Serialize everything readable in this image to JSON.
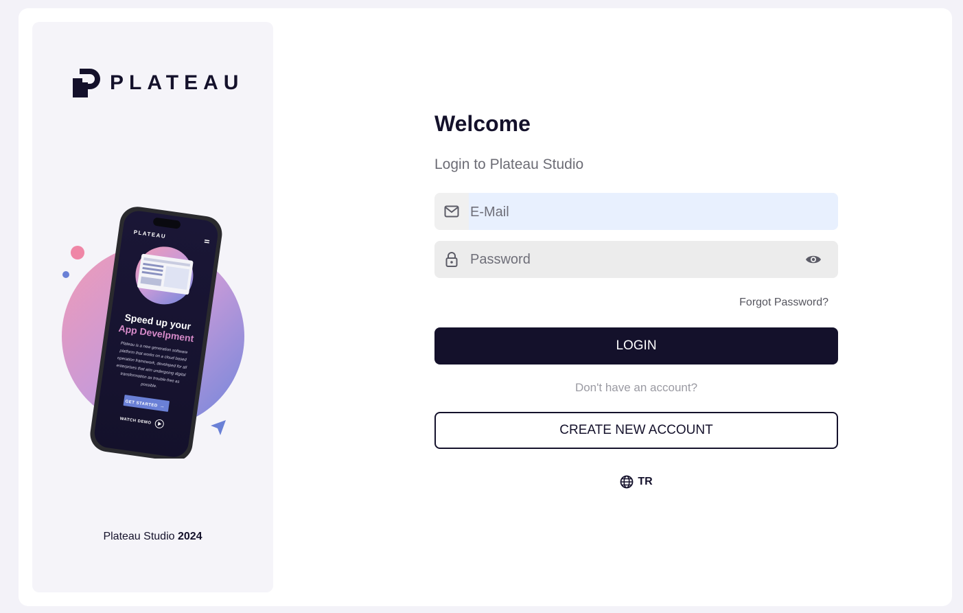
{
  "brand": {
    "name": "PLATEAU"
  },
  "illustration": {
    "phone_brand": "PLATEAU",
    "headline_line1": "Speed up your",
    "headline_line2": "App Develpment",
    "body_lines": [
      "Plateau is a new generation software",
      "platform that works on a cloud based",
      "operation framework, developed for all",
      "enterprises that aim undergoing digital",
      "transformation as trouble-free as",
      "possible."
    ],
    "cta_label": "GET STARTED",
    "demo_label": "WATCH DEMO"
  },
  "footer": {
    "text": "Plateau Studio",
    "year": "2024"
  },
  "login": {
    "title": "Welcome",
    "subtitle": "Login to Plateau Studio",
    "email_placeholder": "E-Mail",
    "password_placeholder": "Password",
    "forgot_label": "Forgot Password?",
    "login_label": "LOGIN",
    "no_account_text": "Don't have an account?",
    "create_label": "CREATE NEW ACCOUNT",
    "language": "TR"
  },
  "icons": {
    "email": "mail-icon",
    "password": "lock-icon",
    "visibility": "eye-icon",
    "language": "globe-icon"
  },
  "colors": {
    "brand_dark": "#14112b",
    "email_bg": "#e8f0fe",
    "field_bg": "#ececec",
    "page_bg": "#f3f2f8"
  }
}
